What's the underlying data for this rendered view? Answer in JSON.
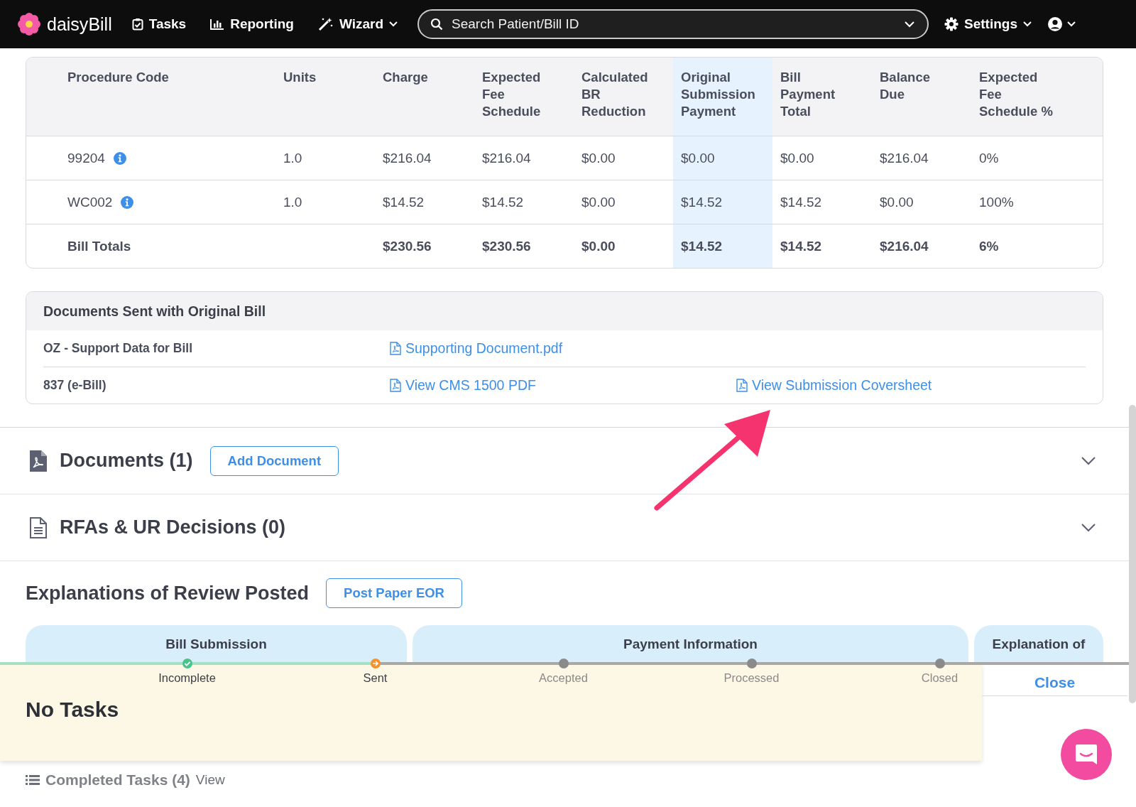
{
  "nav": {
    "logo": "daisy**Bill**",
    "items": [
      {
        "label": "Tasks",
        "dropdown": false
      },
      {
        "label": "Reporting",
        "dropdown": false
      },
      {
        "label": "Wizard",
        "dropdown": true
      }
    ],
    "search": {
      "placeholder": "Search Patient/Bill ID"
    },
    "settings": "Settings"
  },
  "table": {
    "columns": [
      {
        "label": "Procedure Code",
        "highlighted": false
      },
      {
        "label": "Units",
        "highlighted": false
      },
      {
        "label": "Charge",
        "highlighted": false
      },
      {
        "label": "Expected Fee Schedule",
        "highlighted": false
      },
      {
        "label": "Calculated BR Reduction",
        "highlighted": false
      },
      {
        "label": "Original Submission Payment",
        "highlighted": true
      },
      {
        "label": "Bill Payment Total",
        "highlighted": false
      },
      {
        "label": "Balance Due",
        "highlighted": false
      },
      {
        "label": "Expected Fee Schedule %",
        "highlighted": false
      }
    ],
    "rows": [
      {
        "kind": "line",
        "info": true,
        "cells": [
          "99204",
          "1.0",
          "$216.04",
          "$216.04",
          "$0.00",
          "$0.00",
          "$0.00",
          "$216.04",
          "0%"
        ]
      },
      {
        "kind": "line",
        "info": true,
        "cells": [
          "WC002",
          "1.0",
          "$14.52",
          "$14.52",
          "$0.00",
          "$14.52",
          "$14.52",
          "$0.00",
          "100%"
        ]
      },
      {
        "kind": "total",
        "info": false,
        "cells": [
          "Bill Totals",
          "",
          "$230.56",
          "$230.56",
          "$0.00",
          "$14.52",
          "$14.52",
          "$216.04",
          "6%"
        ]
      }
    ]
  },
  "documents_sent": {
    "title": "Documents Sent with Original Bill",
    "rows": [
      {
        "label": "OZ - Support Data for Bill",
        "links": [
          "Supporting Document.pdf"
        ]
      },
      {
        "label": "837 (e-Bill)",
        "links": [
          "View CMS 1500 PDF",
          "View Submission Coversheet"
        ]
      }
    ]
  },
  "sections": [
    {
      "kind": "pdf",
      "title": "Documents (1)",
      "button": "Add Document",
      "expanded": false
    },
    {
      "kind": "file",
      "title": "RFAs & UR Decisions (0)",
      "expanded": false
    }
  ],
  "eor": {
    "title": "Explanations of Review Posted",
    "button": "Post Paper EOR",
    "tabs": [
      "Bill Submission",
      "Payment Information",
      "Explanation of"
    ]
  },
  "timeline": [
    {
      "label": "Incomplete",
      "done": true,
      "current": false
    },
    {
      "label": "Sent",
      "done": false,
      "current": true
    },
    {
      "label": "Accepted",
      "done": false,
      "current": false
    },
    {
      "label": "Processed",
      "done": false,
      "current": false
    },
    {
      "label": "Closed",
      "done": false,
      "current": false
    }
  ],
  "tasks": {
    "title": "No Tasks",
    "close": "Close",
    "completed": "Completed Tasks (4)",
    "view": "View"
  }
}
